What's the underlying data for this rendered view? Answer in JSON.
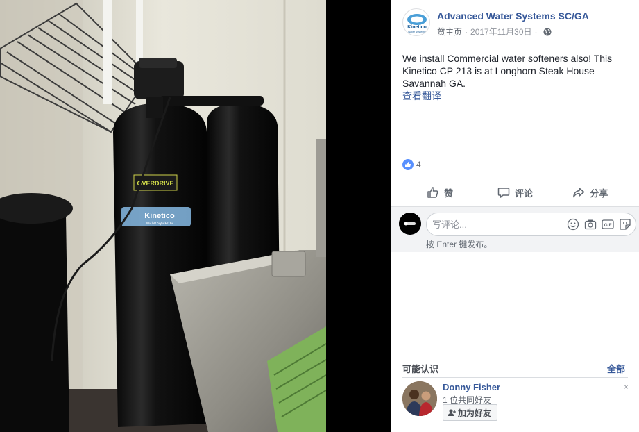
{
  "post": {
    "page_name": "Advanced Water Systems SC/GA",
    "sponsor_label": "赞主页",
    "separator": "·",
    "date": "2017年11月30日",
    "privacy_dot": "·",
    "globe_icon": "globe-icon",
    "text": "We install Commercial water softeners also! This Kinetico CP 213 is at Longhorn Steak House Savannah GA.",
    "see_translation": "查看翻译"
  },
  "photo": {
    "tank_label_brand": "Kinetico",
    "tank_label_sub": "water systems",
    "tank_sticker": "OVERDRIVE"
  },
  "page_logo": {
    "text": "Kinetico",
    "subtext": "water systems"
  },
  "reactions": {
    "icon": "like-reaction-icon",
    "count": "4"
  },
  "actions": {
    "like": "赞",
    "comment": "评论",
    "share": "分享"
  },
  "comment": {
    "placeholder": "写评论...",
    "hint": "按 Enter 键发布。",
    "icons": [
      "emoji-icon",
      "camera-icon",
      "gif-icon",
      "sticker-icon"
    ]
  },
  "pymk": {
    "title": "可能认识",
    "see_all": "全部",
    "person": {
      "name": "Donny Fisher",
      "mutual": "1 位共同好友",
      "add_friend": "加为好友",
      "dismiss": "×"
    }
  },
  "colors": {
    "link": "#365899",
    "like_blue": "#5890ff",
    "muted": "#90949c",
    "comment_bg": "#f2f3f5"
  }
}
